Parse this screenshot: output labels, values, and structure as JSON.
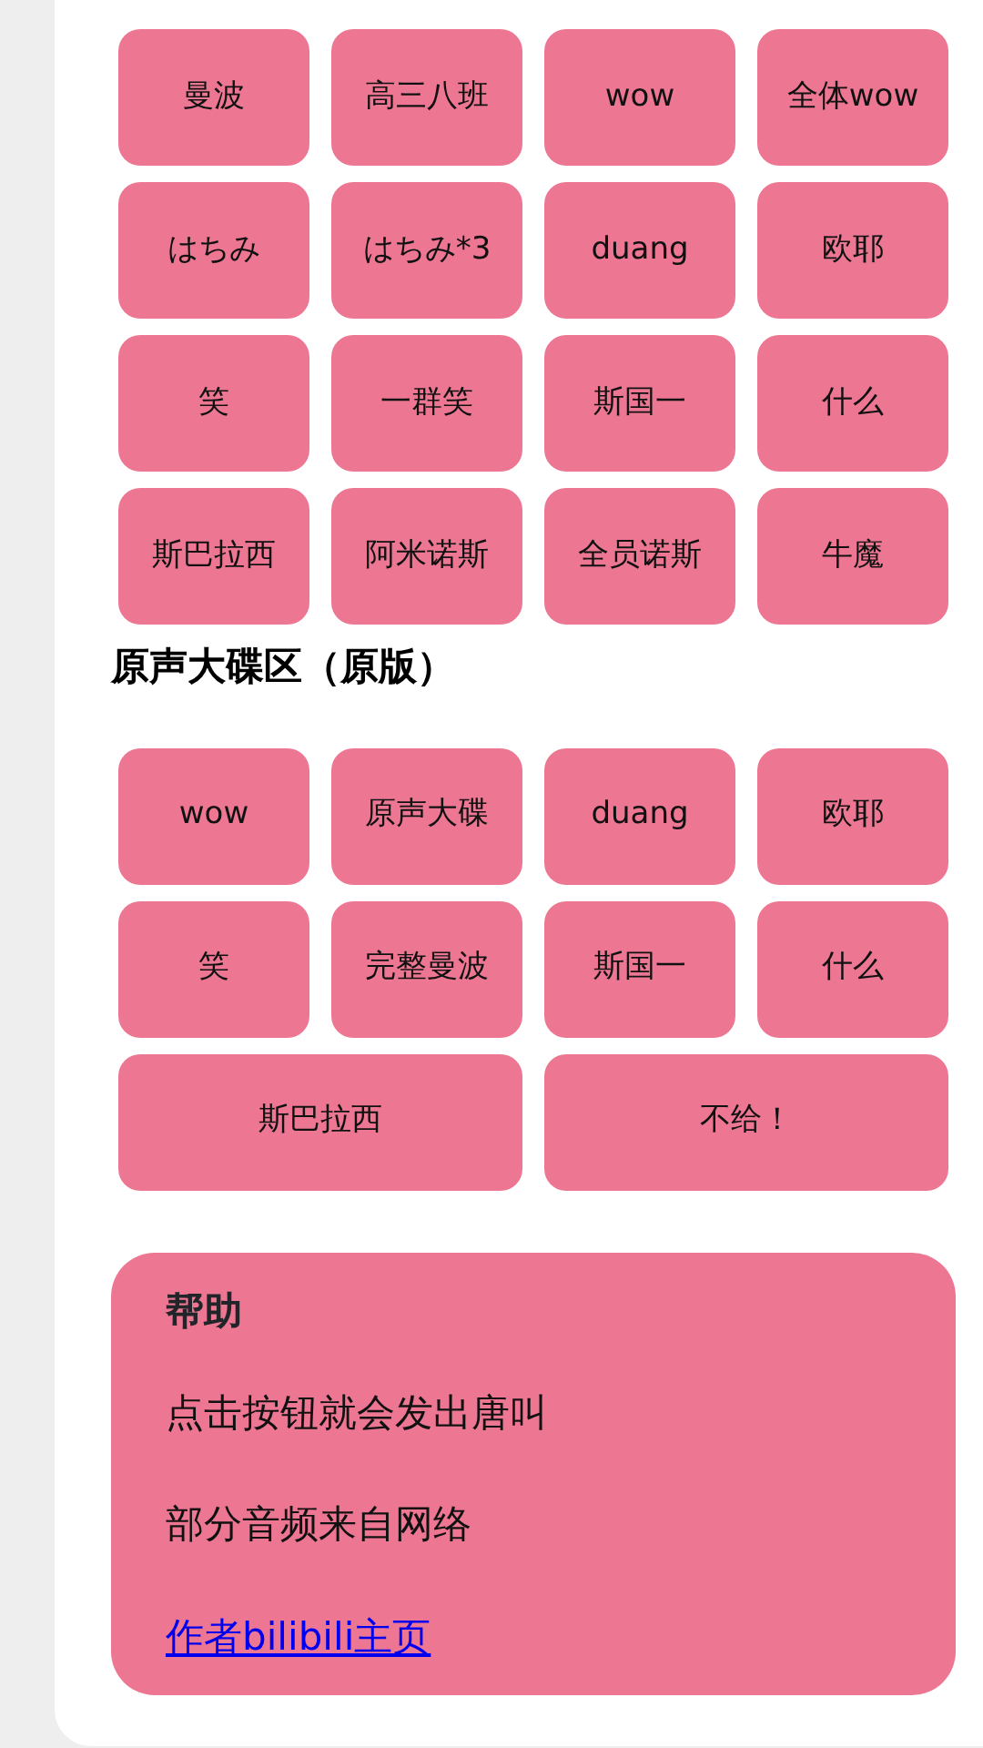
{
  "sections": [
    {
      "buttons": [
        {
          "label": "曼波",
          "kind": "normal"
        },
        {
          "label": "高三八班",
          "kind": "normal"
        },
        {
          "label": "wow",
          "kind": "normal"
        },
        {
          "label": "全体wow",
          "kind": "normal"
        },
        {
          "label": "はちみ",
          "kind": "normal"
        },
        {
          "label": "はちみ*3",
          "kind": "normal"
        },
        {
          "label": "duang",
          "kind": "normal"
        },
        {
          "label": "欧耶",
          "kind": "normal"
        },
        {
          "label": "笑",
          "kind": "normal"
        },
        {
          "label": "一群笑",
          "kind": "normal"
        },
        {
          "label": "斯国一",
          "kind": "normal"
        },
        {
          "label": "什么",
          "kind": "normal"
        },
        {
          "label": "斯巴拉西",
          "kind": "normal"
        },
        {
          "label": "阿米诺斯",
          "kind": "normal"
        },
        {
          "label": "全员诺斯",
          "kind": "normal"
        },
        {
          "label": "牛魔",
          "kind": "normal"
        }
      ]
    },
    {
      "title": "原声大碟区（原版）",
      "buttons": [
        {
          "label": "wow",
          "kind": "normal"
        },
        {
          "label": "原声大碟",
          "kind": "normal"
        },
        {
          "label": "duang",
          "kind": "normal"
        },
        {
          "label": "欧耶",
          "kind": "normal"
        },
        {
          "label": "笑",
          "kind": "normal"
        },
        {
          "label": "完整曼波",
          "kind": "normal"
        },
        {
          "label": "斯国一",
          "kind": "normal"
        },
        {
          "label": "什么",
          "kind": "normal"
        },
        {
          "label": "斯巴拉西",
          "kind": "wide"
        },
        {
          "label": "不给！",
          "kind": "wide"
        }
      ]
    }
  ],
  "help": {
    "title": "帮助",
    "lines": [
      "点击按钮就会发出唐叫",
      "部分音频来自网络"
    ],
    "link": "作者bilibili主页"
  }
}
